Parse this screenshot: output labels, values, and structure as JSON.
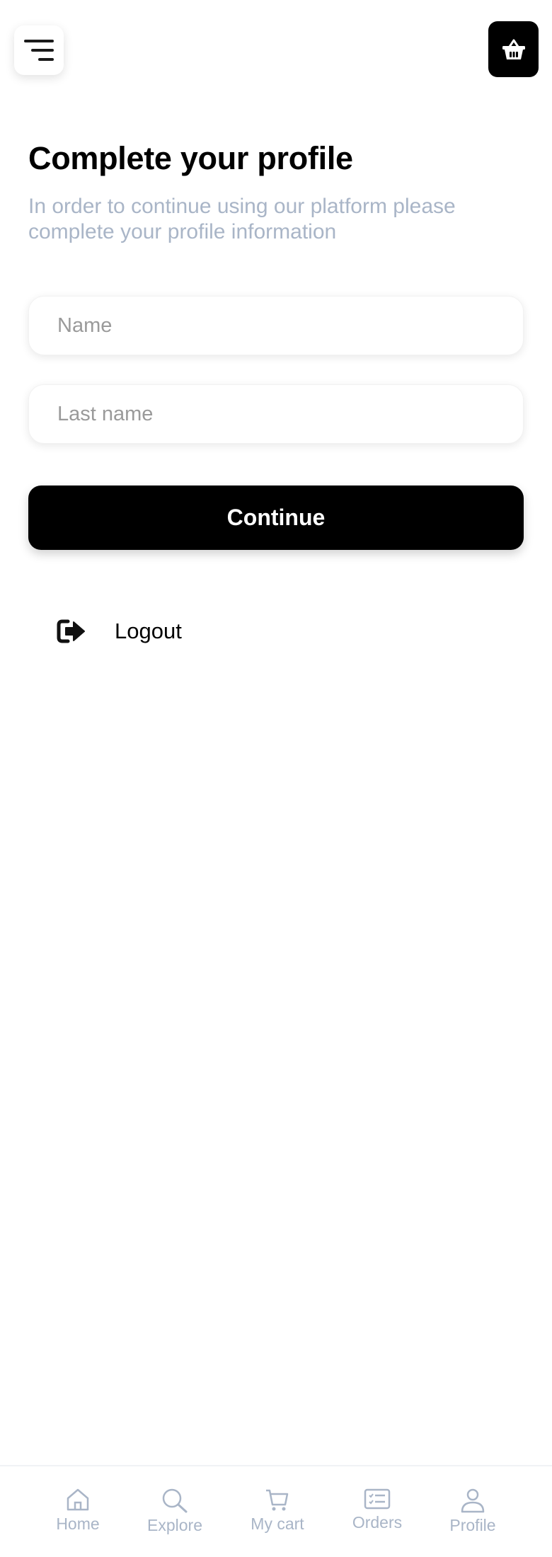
{
  "header": {
    "menu_icon": "menu-icon",
    "cart_icon": "basket-icon"
  },
  "main": {
    "title": "Complete your profile",
    "subtitle": "In order to continue using our platform please complete your profile information",
    "name_field": {
      "placeholder": "Name",
      "value": ""
    },
    "last_name_field": {
      "placeholder": "Last name",
      "value": ""
    },
    "continue_label": "Continue",
    "logout_label": "Logout",
    "logout_icon": "logout-icon"
  },
  "tabbar": {
    "items": [
      {
        "label": "Home",
        "icon": "home-icon"
      },
      {
        "label": "Explore",
        "icon": "search-icon"
      },
      {
        "label": "My cart",
        "icon": "cart-icon"
      },
      {
        "label": "Orders",
        "icon": "orders-icon"
      },
      {
        "label": "Profile",
        "icon": "profile-icon"
      }
    ]
  },
  "colors": {
    "accent": "#000000",
    "muted_text": "#a9b5c7",
    "placeholder": "#9a9a9a",
    "background": "#ffffff"
  }
}
